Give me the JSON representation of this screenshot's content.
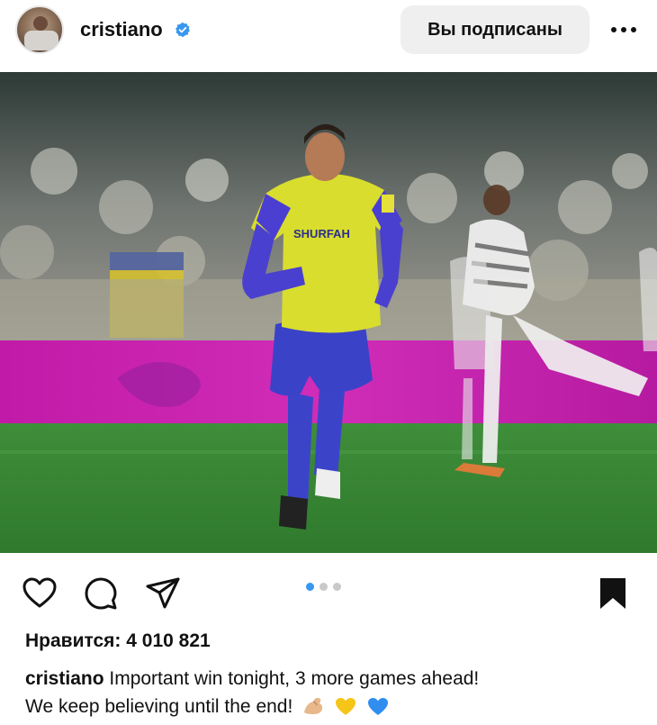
{
  "header": {
    "username": "cristiano",
    "follow_label": "Вы подписаны"
  },
  "photo": {
    "sponsor_text": "SHURFAH"
  },
  "carousel": {
    "count": 3,
    "active_index": 0
  },
  "likes": {
    "text": "Нравится: 4 010 821"
  },
  "caption": {
    "username": "cristiano",
    "line1": "Important win tonight, 3 more games ahead!",
    "line2": "We keep believing until the end!"
  },
  "icons": {
    "verified": "verified-badge-icon",
    "more": "more-options-icon",
    "like": "heart-icon",
    "comment": "comment-icon",
    "share": "paper-plane-icon",
    "save": "bookmark-icon"
  },
  "colors": {
    "verified": "#3897f0",
    "accent_dot": "#3897f0",
    "button_bg": "#efefef"
  }
}
